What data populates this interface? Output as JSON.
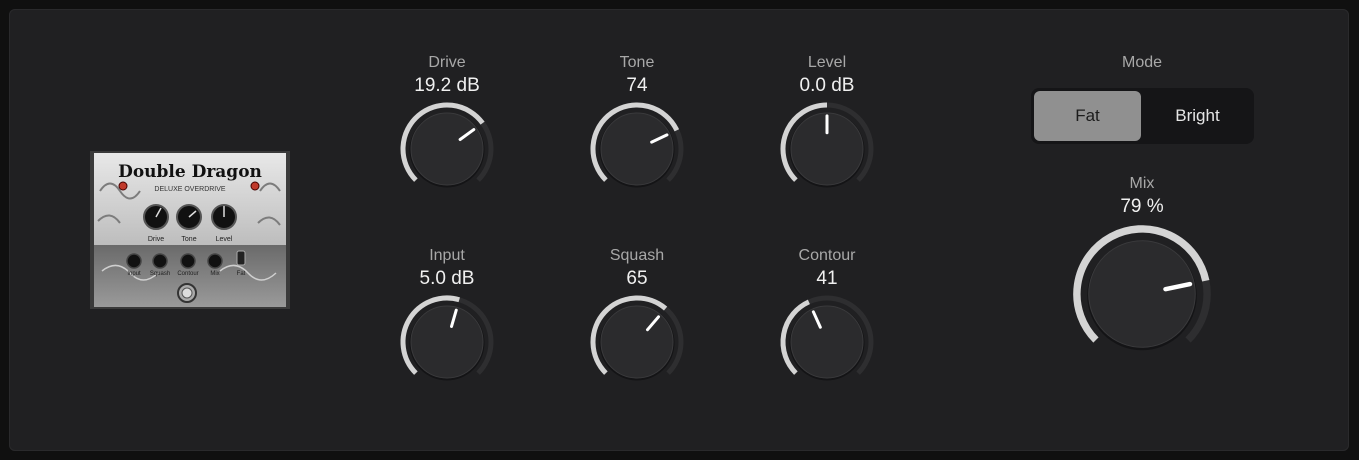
{
  "pedal": {
    "title": "Double Dragon",
    "subtitle": "DELUXE OVERDRIVE",
    "knob_labels_top": [
      "Drive",
      "Tone",
      "Level"
    ],
    "knob_labels_bottom": [
      "Input",
      "Squash",
      "Contour",
      "Mix"
    ],
    "switch_label": "Fat"
  },
  "knobs": {
    "drive": {
      "label": "Drive",
      "value": "19.2 dB",
      "fraction": 0.7
    },
    "tone": {
      "label": "Tone",
      "value": "74",
      "fraction": 0.74
    },
    "level": {
      "label": "Level",
      "value": "0.0 dB",
      "fraction": 0.5
    },
    "input": {
      "label": "Input",
      "value": "5.0 dB",
      "fraction": 0.56
    },
    "squash": {
      "label": "Squash",
      "value": "65",
      "fraction": 0.65
    },
    "contour": {
      "label": "Contour",
      "value": "41",
      "fraction": 0.41
    }
  },
  "mode": {
    "label": "Mode",
    "options": [
      "Fat",
      "Bright"
    ],
    "selected": "Fat"
  },
  "mix": {
    "label": "Mix",
    "value": "79 %",
    "fraction": 0.79
  },
  "colors": {
    "panel": "#202022",
    "arc_active": "#d4d4d4",
    "arc_track": "#2e2e30",
    "knob_body": "#2b2b2d",
    "indicator": "#ffffff"
  }
}
